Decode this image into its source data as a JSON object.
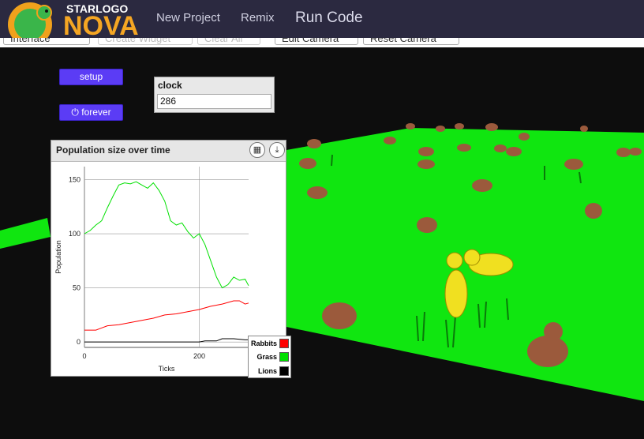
{
  "app": {
    "logo_top": "STARLOGO",
    "logo_main": "NOVA",
    "nav": [
      "New Project",
      "Remix"
    ],
    "run_code": "Run Code"
  },
  "toolbar": {
    "items": [
      "Interface",
      "Create Widget",
      "Clear All",
      "Edit Camera",
      "Reset Camera"
    ]
  },
  "widgets": {
    "setup_label": "setup",
    "forever_label": "forever",
    "forever_icon": "power-icon",
    "clock_label": "clock",
    "clock_value": "286"
  },
  "colors": {
    "grass": "#10e610",
    "background": "#0d0d0d",
    "button": "#5b3cf5",
    "topbar": "#2b2940"
  },
  "chart_data": {
    "type": "line",
    "title": "Population size over time",
    "xlabel": "Ticks",
    "ylabel": "Population",
    "xlim": [
      0,
      286
    ],
    "ylim": [
      -5,
      162
    ],
    "xticks": [
      0,
      200
    ],
    "yticks": [
      0,
      50,
      100,
      150
    ],
    "grid": true,
    "legend_position": "bottom-right",
    "series": [
      {
        "name": "Rabbits",
        "color": "#ff0000",
        "x": [
          0,
          20,
          40,
          60,
          80,
          100,
          120,
          140,
          160,
          180,
          200,
          220,
          240,
          260,
          270,
          280,
          286
        ],
        "y": [
          11,
          11,
          15,
          16,
          18,
          20,
          22,
          25,
          26,
          28,
          30,
          33,
          35,
          38,
          38,
          35,
          36
        ]
      },
      {
        "name": "Grass",
        "color": "#00e000",
        "x": [
          0,
          10,
          20,
          30,
          40,
          50,
          60,
          70,
          80,
          90,
          100,
          110,
          120,
          130,
          140,
          150,
          160,
          170,
          180,
          190,
          200,
          210,
          220,
          230,
          240,
          250,
          260,
          270,
          280,
          286
        ],
        "y": [
          100,
          103,
          108,
          112,
          124,
          135,
          145,
          147,
          146,
          148,
          145,
          142,
          147,
          140,
          130,
          112,
          108,
          110,
          102,
          96,
          100,
          90,
          75,
          60,
          50,
          53,
          60,
          57,
          58,
          52
        ]
      },
      {
        "name": "Lions",
        "color": "#000000",
        "x": [
          0,
          50,
          100,
          150,
          200,
          210,
          220,
          230,
          240,
          260,
          280,
          286
        ],
        "y": [
          0,
          0,
          0,
          0,
          0,
          1,
          1,
          1,
          3,
          3,
          2,
          2
        ]
      }
    ]
  }
}
